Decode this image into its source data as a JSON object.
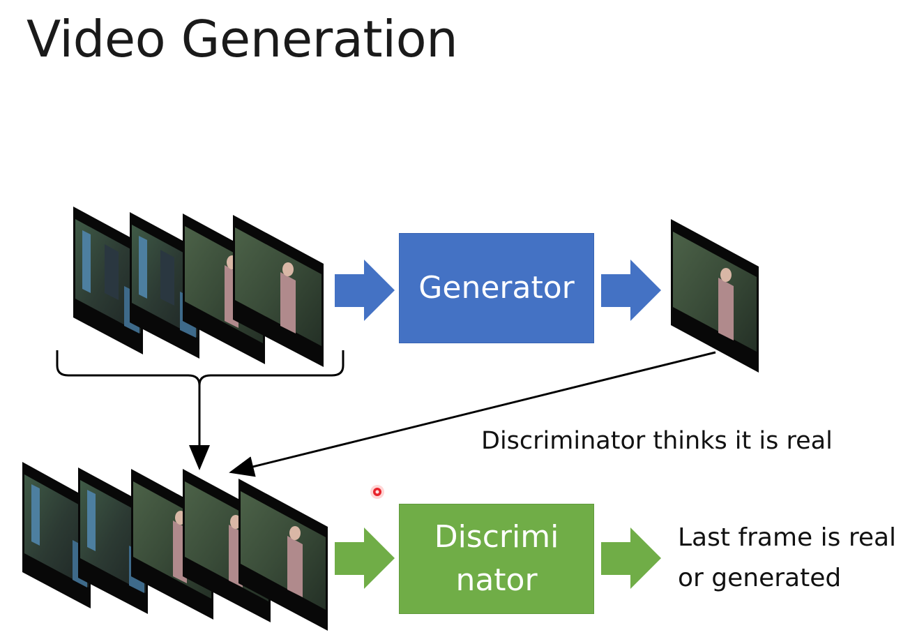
{
  "slide": {
    "title": "Video Generation"
  },
  "generator": {
    "label": "Generator",
    "color": "#4472c4"
  },
  "discriminator": {
    "label_line1": "Discrimi",
    "label_line2": "nator",
    "color": "#70ad47"
  },
  "annotations": {
    "discriminator_thinks": "Discriminator thinks it is real",
    "output_line1": "Last frame is real",
    "output_line2": "or generated"
  },
  "icons": {
    "video_frame": "video-frame-icon",
    "arrow": "block-arrow-icon",
    "brace": "curly-brace-icon",
    "pointer": "laser-pointer-icon"
  }
}
